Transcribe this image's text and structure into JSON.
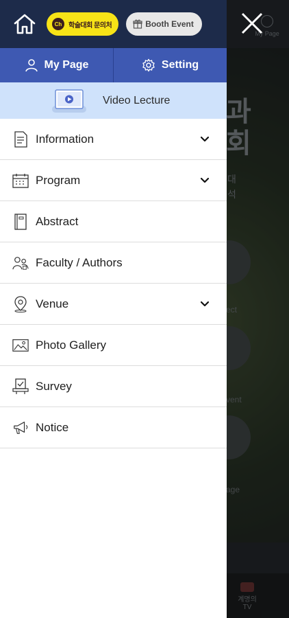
{
  "header": {
    "kakao_label": "학술대회 문의처",
    "kakao_badge": "Ch",
    "booth_label": "Booth Event"
  },
  "user_row": {
    "mypage_label": "My Page",
    "setting_label": "Setting"
  },
  "video": {
    "label": "Video Lecture"
  },
  "menu": [
    {
      "label": "Information",
      "icon": "document-icon",
      "expandable": true
    },
    {
      "label": "Program",
      "icon": "calendar-icon",
      "expandable": true
    },
    {
      "label": "Abstract",
      "icon": "book-icon",
      "expandable": false
    },
    {
      "label": "Faculty / Authors",
      "icon": "people-icon",
      "expandable": false
    },
    {
      "label": "Venue",
      "icon": "map-pin-icon",
      "expandable": true
    },
    {
      "label": "Photo Gallery",
      "icon": "image-icon",
      "expandable": false
    },
    {
      "label": "Survey",
      "icon": "survey-icon",
      "expandable": false
    },
    {
      "label": "Notice",
      "icon": "megaphone-icon",
      "expandable": false
    }
  ],
  "background": {
    "mypage_label": "My Page",
    "title_lines": [
      "과",
      "회"
    ],
    "sub_lines": [
      "대",
      "석"
    ],
    "labels": [
      "ect",
      "vent",
      "age"
    ],
    "tv_label": "계명의 TV"
  },
  "colors": {
    "header_bg": "#1d2b4a",
    "user_row_bg": "#3e59b2",
    "video_row_bg": "#cfe2fb",
    "kakao_yellow": "#f7e317"
  }
}
